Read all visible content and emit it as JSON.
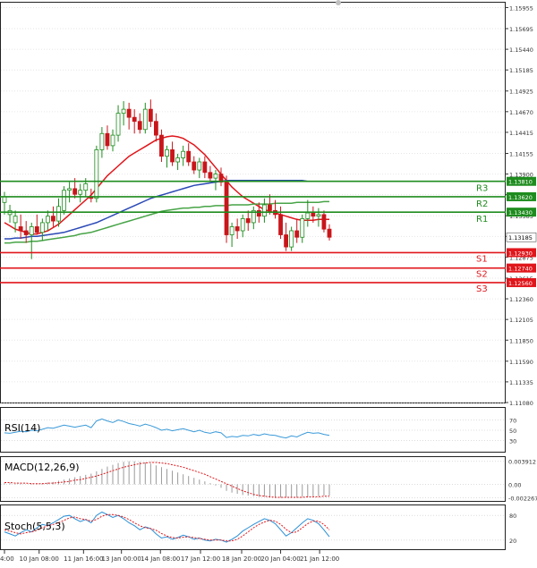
{
  "chart_data": {
    "type": "candlestick",
    "main_panel": {
      "price_ylim": [
        1.1108,
        1.1596
      ],
      "price_ticks": [
        "1.15955",
        "1.15695",
        "1.15440",
        "1.15185",
        "1.14925",
        "1.14670",
        "1.14415",
        "1.14155",
        "1.13900",
        "1.13645",
        "1.13385",
        "1.13130",
        "1.12875",
        "1.12615",
        "1.12360",
        "1.12105",
        "1.11850",
        "1.11590",
        "1.11335",
        "1.11080"
      ],
      "current_price_label": "1.13185",
      "levels": [
        {
          "label": "R3",
          "value": 1.1381,
          "value_label": "1.13810",
          "color": "#1e8c1e"
        },
        {
          "label": "R2",
          "value": 1.1362,
          "value_label": "1.13620",
          "color": "#1e8c1e"
        },
        {
          "label": "R1",
          "value": 1.1343,
          "value_label": "1.13430",
          "color": "#1e8c1e"
        },
        {
          "label": "S1",
          "value": 1.1293,
          "value_label": "1.12930",
          "color": "#e0161b"
        },
        {
          "label": "S2",
          "value": 1.1274,
          "value_label": "1.12740",
          "color": "#e0161b"
        },
        {
          "label": "S3",
          "value": 1.1256,
          "value_label": "1.12560",
          "color": "#e0161b"
        }
      ],
      "candles": [
        [
          1.1355,
          1.1368,
          1.134,
          1.1362
        ],
        [
          1.134,
          1.1352,
          1.133,
          1.1345
        ],
        [
          1.133,
          1.1345,
          1.1318,
          1.1338
        ],
        [
          1.1325,
          1.134,
          1.131,
          1.132
        ],
        [
          1.132,
          1.1332,
          1.1305,
          1.1315
        ],
        [
          1.1315,
          1.133,
          1.1285,
          1.1325
        ],
        [
          1.1325,
          1.134,
          1.1315,
          1.1318
        ],
        [
          1.1318,
          1.1335,
          1.1308,
          1.133
        ],
        [
          1.133,
          1.1345,
          1.132,
          1.1338
        ],
        [
          1.1338,
          1.135,
          1.1325,
          1.1332
        ],
        [
          1.1332,
          1.136,
          1.1325,
          1.135
        ],
        [
          1.1345,
          1.1375,
          1.134,
          1.137
        ],
        [
          1.137,
          1.138,
          1.1355,
          1.1372
        ],
        [
          1.1372,
          1.1385,
          1.136,
          1.1365
        ],
        [
          1.1365,
          1.1378,
          1.1355,
          1.137
        ],
        [
          1.137,
          1.1385,
          1.1362,
          1.1378
        ],
        [
          1.1362,
          1.1372,
          1.1355,
          1.136
        ],
        [
          1.136,
          1.1425,
          1.1355,
          1.142
        ],
        [
          1.142,
          1.1448,
          1.141,
          1.144
        ],
        [
          1.144,
          1.145,
          1.142,
          1.1425
        ],
        [
          1.1425,
          1.1445,
          1.1418,
          1.1438
        ],
        [
          1.1438,
          1.1475,
          1.143,
          1.1465
        ],
        [
          1.1465,
          1.148,
          1.145,
          1.147
        ],
        [
          1.147,
          1.1478,
          1.1445,
          1.146
        ],
        [
          1.146,
          1.147,
          1.144,
          1.1455
        ],
        [
          1.1455,
          1.1465,
          1.144,
          1.1445
        ],
        [
          1.1445,
          1.1478,
          1.144,
          1.147
        ],
        [
          1.147,
          1.1482,
          1.1448,
          1.1455
        ],
        [
          1.1455,
          1.1465,
          1.143,
          1.1438
        ],
        [
          1.1438,
          1.1445,
          1.1405,
          1.1412
        ],
        [
          1.1412,
          1.1425,
          1.1398,
          1.142
        ],
        [
          1.142,
          1.143,
          1.14,
          1.1405
        ],
        [
          1.1405,
          1.1415,
          1.1395,
          1.141
        ],
        [
          1.141,
          1.1425,
          1.14,
          1.1418
        ],
        [
          1.1418,
          1.1428,
          1.14,
          1.1405
        ],
        [
          1.1405,
          1.1412,
          1.139,
          1.1395
        ],
        [
          1.1395,
          1.141,
          1.1385,
          1.1405
        ],
        [
          1.1405,
          1.1412,
          1.1385,
          1.1392
        ],
        [
          1.1392,
          1.14,
          1.138,
          1.1385
        ],
        [
          1.1385,
          1.1395,
          1.137,
          1.139
        ],
        [
          1.139,
          1.1398,
          1.1375,
          1.138
        ],
        [
          1.138,
          1.1388,
          1.1305,
          1.1315
        ],
        [
          1.1315,
          1.133,
          1.13,
          1.1325
        ],
        [
          1.1325,
          1.1335,
          1.131,
          1.132
        ],
        [
          1.132,
          1.134,
          1.1312,
          1.1335
        ],
        [
          1.1335,
          1.1345,
          1.132,
          1.133
        ],
        [
          1.133,
          1.135,
          1.1322,
          1.1345
        ],
        [
          1.1345,
          1.1355,
          1.133,
          1.1338
        ],
        [
          1.1338,
          1.136,
          1.133,
          1.1352
        ],
        [
          1.1352,
          1.1365,
          1.134,
          1.1345
        ],
        [
          1.1345,
          1.1358,
          1.1335,
          1.134
        ],
        [
          1.134,
          1.135,
          1.131,
          1.1315
        ],
        [
          1.1315,
          1.133,
          1.1295,
          1.13
        ],
        [
          1.13,
          1.1325,
          1.1295,
          1.132
        ],
        [
          1.132,
          1.1335,
          1.1305,
          1.1312
        ],
        [
          1.1312,
          1.134,
          1.1305,
          1.1335
        ],
        [
          1.1335,
          1.1358,
          1.1325,
          1.1342
        ],
        [
          1.1342,
          1.135,
          1.133,
          1.1338
        ],
        [
          1.1338,
          1.1348,
          1.1325,
          1.134
        ],
        [
          1.134,
          1.1345,
          1.1318,
          1.1322
        ],
        [
          1.1322,
          1.1328,
          1.1308,
          1.1312
        ]
      ],
      "moving_averages": [
        {
          "color": "#e0161b",
          "values": [
            1.133,
            1.1326,
            1.1322,
            1.132,
            1.1318,
            1.1316,
            1.1316,
            1.1318,
            1.132,
            1.1324,
            1.1328,
            1.1334,
            1.134,
            1.1346,
            1.1352,
            1.1358,
            1.1364,
            1.1372,
            1.138,
            1.1388,
            1.1394,
            1.14,
            1.1406,
            1.1412,
            1.1416,
            1.142,
            1.1424,
            1.1428,
            1.1432,
            1.1434,
            1.1436,
            1.1437,
            1.1436,
            1.1434,
            1.143,
            1.1426,
            1.142,
            1.1414,
            1.1406,
            1.1398,
            1.139,
            1.1382,
            1.1374,
            1.1368,
            1.1362,
            1.1358,
            1.1354,
            1.135,
            1.1346,
            1.1344,
            1.1342,
            1.134,
            1.1338,
            1.1336,
            1.1334,
            1.1333,
            1.1333,
            1.1333,
            1.1334,
            1.1334,
            1.1334
          ]
        },
        {
          "color": "#2b49b6",
          "values": [
            1.131,
            1.131,
            1.1311,
            1.1311,
            1.1312,
            1.1313,
            1.1313,
            1.1314,
            1.1315,
            1.1316,
            1.1317,
            1.1318,
            1.132,
            1.1322,
            1.1324,
            1.1326,
            1.1328,
            1.133,
            1.1333,
            1.1336,
            1.1339,
            1.1342,
            1.1345,
            1.1348,
            1.1351,
            1.1354,
            1.1357,
            1.136,
            1.1362,
            1.1364,
            1.1366,
            1.1368,
            1.137,
            1.1372,
            1.1374,
            1.1376,
            1.1377,
            1.1378,
            1.1379,
            1.138,
            1.1381,
            1.1382,
            1.1382,
            1.1382,
            1.1382,
            1.1382,
            1.1382,
            1.1382,
            1.1382,
            1.1382,
            1.1382,
            1.1382,
            1.1382,
            1.1382,
            1.1382,
            1.1382,
            1.1381,
            1.1381,
            1.1381,
            1.1381,
            1.1381
          ]
        },
        {
          "color": "#47a447",
          "values": [
            1.1305,
            1.1305,
            1.1306,
            1.1306,
            1.1306,
            1.1307,
            1.1307,
            1.1308,
            1.1309,
            1.131,
            1.1311,
            1.1312,
            1.1313,
            1.1314,
            1.1316,
            1.1317,
            1.1318,
            1.132,
            1.1322,
            1.1324,
            1.1326,
            1.1328,
            1.133,
            1.1332,
            1.1334,
            1.1336,
            1.1338,
            1.134,
            1.1342,
            1.1344,
            1.1345,
            1.1346,
            1.1347,
            1.1348,
            1.1348,
            1.1349,
            1.1349,
            1.135,
            1.135,
            1.1351,
            1.1351,
            1.1351,
            1.1352,
            1.1352,
            1.1352,
            1.1352,
            1.1353,
            1.1353,
            1.1353,
            1.1353,
            1.1354,
            1.1354,
            1.1354,
            1.1354,
            1.1355,
            1.1355,
            1.1355,
            1.1355,
            1.1355,
            1.1356,
            1.1356
          ]
        }
      ]
    },
    "x_axis": {
      "tick_labels": [
        "4:00",
        "10 Jan 08:00",
        "11 Jan 16:00",
        "13 Jan 00:00",
        "14 Jan 08:00",
        "17 Jan 12:00",
        "18 Jan 20:00",
        "20 Jan 04:00",
        "21 Jan 12:00"
      ],
      "tick_candle_index": [
        0.0,
        6.4,
        14.6,
        21.6,
        28.8,
        36.2,
        43.8,
        51.0,
        58.2
      ]
    },
    "rsi_panel": {
      "label": "RSI(14)",
      "ticks": [
        "70",
        "50",
        "30"
      ],
      "ylim": [
        10,
        90
      ],
      "values": [
        45,
        44,
        46,
        48,
        47,
        50,
        49,
        52,
        55,
        54,
        57,
        60,
        58,
        56,
        58,
        60,
        55,
        68,
        72,
        68,
        65,
        70,
        67,
        63,
        61,
        58,
        62,
        59,
        55,
        50,
        52,
        49,
        51,
        53,
        50,
        47,
        50,
        46,
        44,
        47,
        45,
        36,
        38,
        37,
        40,
        39,
        42,
        40,
        43,
        41,
        40,
        37,
        35,
        39,
        37,
        42,
        46,
        44,
        45,
        42,
        40
      ]
    },
    "macd_panel": {
      "label": "MACD(12,26,9)",
      "ticks": [
        "0.003912",
        "0.00",
        "-0.002267"
      ],
      "ylim": [
        -0.00265,
        0.0043
      ],
      "histogram": [
        0.0002,
        0.0002,
        0.0001,
        0.0001,
        0.0,
        0.0001,
        0.0001,
        0.0002,
        0.0003,
        0.0004,
        0.0006,
        0.0008,
        0.001,
        0.0012,
        0.0014,
        0.0016,
        0.0018,
        0.0022,
        0.0026,
        0.003,
        0.0033,
        0.0036,
        0.0038,
        0.0039,
        0.0039,
        0.0038,
        0.0037,
        0.0035,
        0.0032,
        0.0029,
        0.0026,
        0.0023,
        0.002,
        0.0017,
        0.0014,
        0.0011,
        0.0008,
        0.0005,
        0.0002,
        -0.0002,
        -0.0006,
        -0.0011,
        -0.0014,
        -0.0016,
        -0.0018,
        -0.0019,
        -0.002,
        -0.0021,
        -0.0021,
        -0.0022,
        -0.0022,
        -0.0022,
        -0.0022,
        -0.0022,
        -0.0022,
        -0.0021,
        -0.0021,
        -0.002,
        -0.002,
        -0.0019,
        -0.0019
      ],
      "signal": [
        0.0003,
        0.0003,
        0.0002,
        0.0002,
        0.0002,
        0.0001,
        0.0001,
        0.0001,
        0.0002,
        0.0002,
        0.0003,
        0.0004,
        0.0005,
        0.0007,
        0.0008,
        0.001,
        0.0012,
        0.0014,
        0.0017,
        0.002,
        0.0023,
        0.0026,
        0.0029,
        0.0031,
        0.0033,
        0.0035,
        0.0036,
        0.0037,
        0.0037,
        0.0036,
        0.0035,
        0.0033,
        0.0031,
        0.0029,
        0.0026,
        0.0023,
        0.002,
        0.0017,
        0.0013,
        0.0009,
        0.0005,
        0.0001,
        -0.0003,
        -0.0007,
        -0.0011,
        -0.0014,
        -0.0017,
        -0.0019,
        -0.002,
        -0.0021,
        -0.0022,
        -0.0022,
        -0.0022,
        -0.0022,
        -0.0022,
        -0.0022,
        -0.0021,
        -0.0021,
        -0.0021,
        -0.002,
        -0.002
      ]
    },
    "stoch_panel": {
      "label": "Stoch(5,5,3)",
      "ticks": [
        "80",
        "20"
      ],
      "ylim": [
        0,
        100
      ],
      "k": [
        40,
        35,
        30,
        38,
        45,
        40,
        50,
        58,
        55,
        62,
        70,
        78,
        80,
        72,
        65,
        70,
        62,
        80,
        88,
        82,
        75,
        80,
        72,
        62,
        55,
        45,
        52,
        48,
        35,
        25,
        28,
        22,
        26,
        32,
        28,
        22,
        25,
        20,
        18,
        22,
        20,
        15,
        22,
        30,
        42,
        50,
        58,
        65,
        72,
        68,
        60,
        45,
        30,
        38,
        50,
        62,
        72,
        68,
        60,
        45,
        28
      ],
      "d": [
        45,
        42,
        38,
        35,
        38,
        40,
        44,
        50,
        55,
        58,
        62,
        68,
        74,
        76,
        72,
        70,
        66,
        70,
        78,
        82,
        82,
        80,
        76,
        70,
        62,
        55,
        50,
        48,
        44,
        36,
        30,
        26,
        25,
        27,
        28,
        26,
        24,
        22,
        20,
        20,
        20,
        18,
        18,
        22,
        30,
        40,
        50,
        58,
        64,
        68,
        66,
        58,
        46,
        38,
        40,
        50,
        60,
        66,
        66,
        58,
        45
      ]
    }
  }
}
